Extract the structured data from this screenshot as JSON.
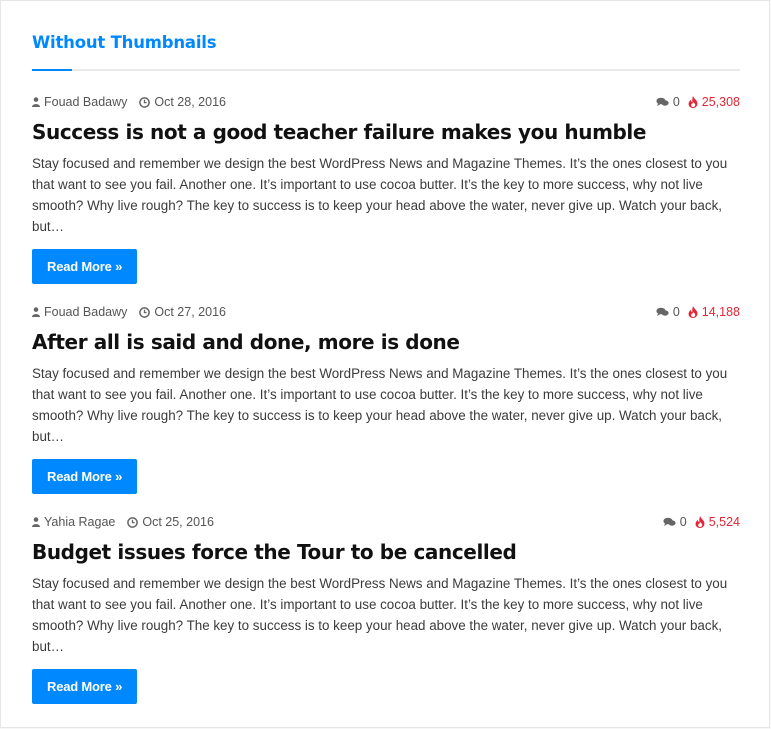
{
  "widget": {
    "title": "Without Thumbnails",
    "accent_color": "#0088ff",
    "views_color": "#e32636"
  },
  "posts": [
    {
      "author": "Fouad Badawy",
      "date": "Oct 28, 2016",
      "comments": "0",
      "views": "25,308",
      "title": "Success is not a good teacher failure makes you humble",
      "excerpt": "Stay focused and remember we design the best WordPress News and Magazine Themes. It’s the ones closest to you that want to see you fail. Another one. It’s important to use cocoa butter. It’s the key to more success, why not live smooth? Why live rough? The key to success is to keep your head above the water, never give up. Watch your back, but…",
      "read_more": "Read More »"
    },
    {
      "author": "Fouad Badawy",
      "date": "Oct 27, 2016",
      "comments": "0",
      "views": "14,188",
      "title": "After all is said and done, more is done",
      "excerpt": "Stay focused and remember we design the best WordPress News and Magazine Themes. It’s the ones closest to you that want to see you fail. Another one. It’s important to use cocoa butter. It’s the key to more success, why not live smooth? Why live rough? The key to success is to keep your head above the water, never give up. Watch your back, but…",
      "read_more": "Read More »"
    },
    {
      "author": "Yahia Ragae",
      "date": "Oct 25, 2016",
      "comments": "0",
      "views": "5,524",
      "title": "Budget issues force the Tour to be cancelled",
      "excerpt": "Stay focused and remember we design the best WordPress News and Magazine Themes. It’s the ones closest to you that want to see you fail. Another one. It’s important to use cocoa butter. It’s the key to more success, why not live smooth? Why live rough? The key to success is to keep your head above the water, never give up. Watch your back, but…",
      "read_more": "Read More »"
    }
  ],
  "icons": {
    "author": "user-icon",
    "date": "clock-icon",
    "comments": "comments-icon",
    "views": "fire-icon"
  }
}
